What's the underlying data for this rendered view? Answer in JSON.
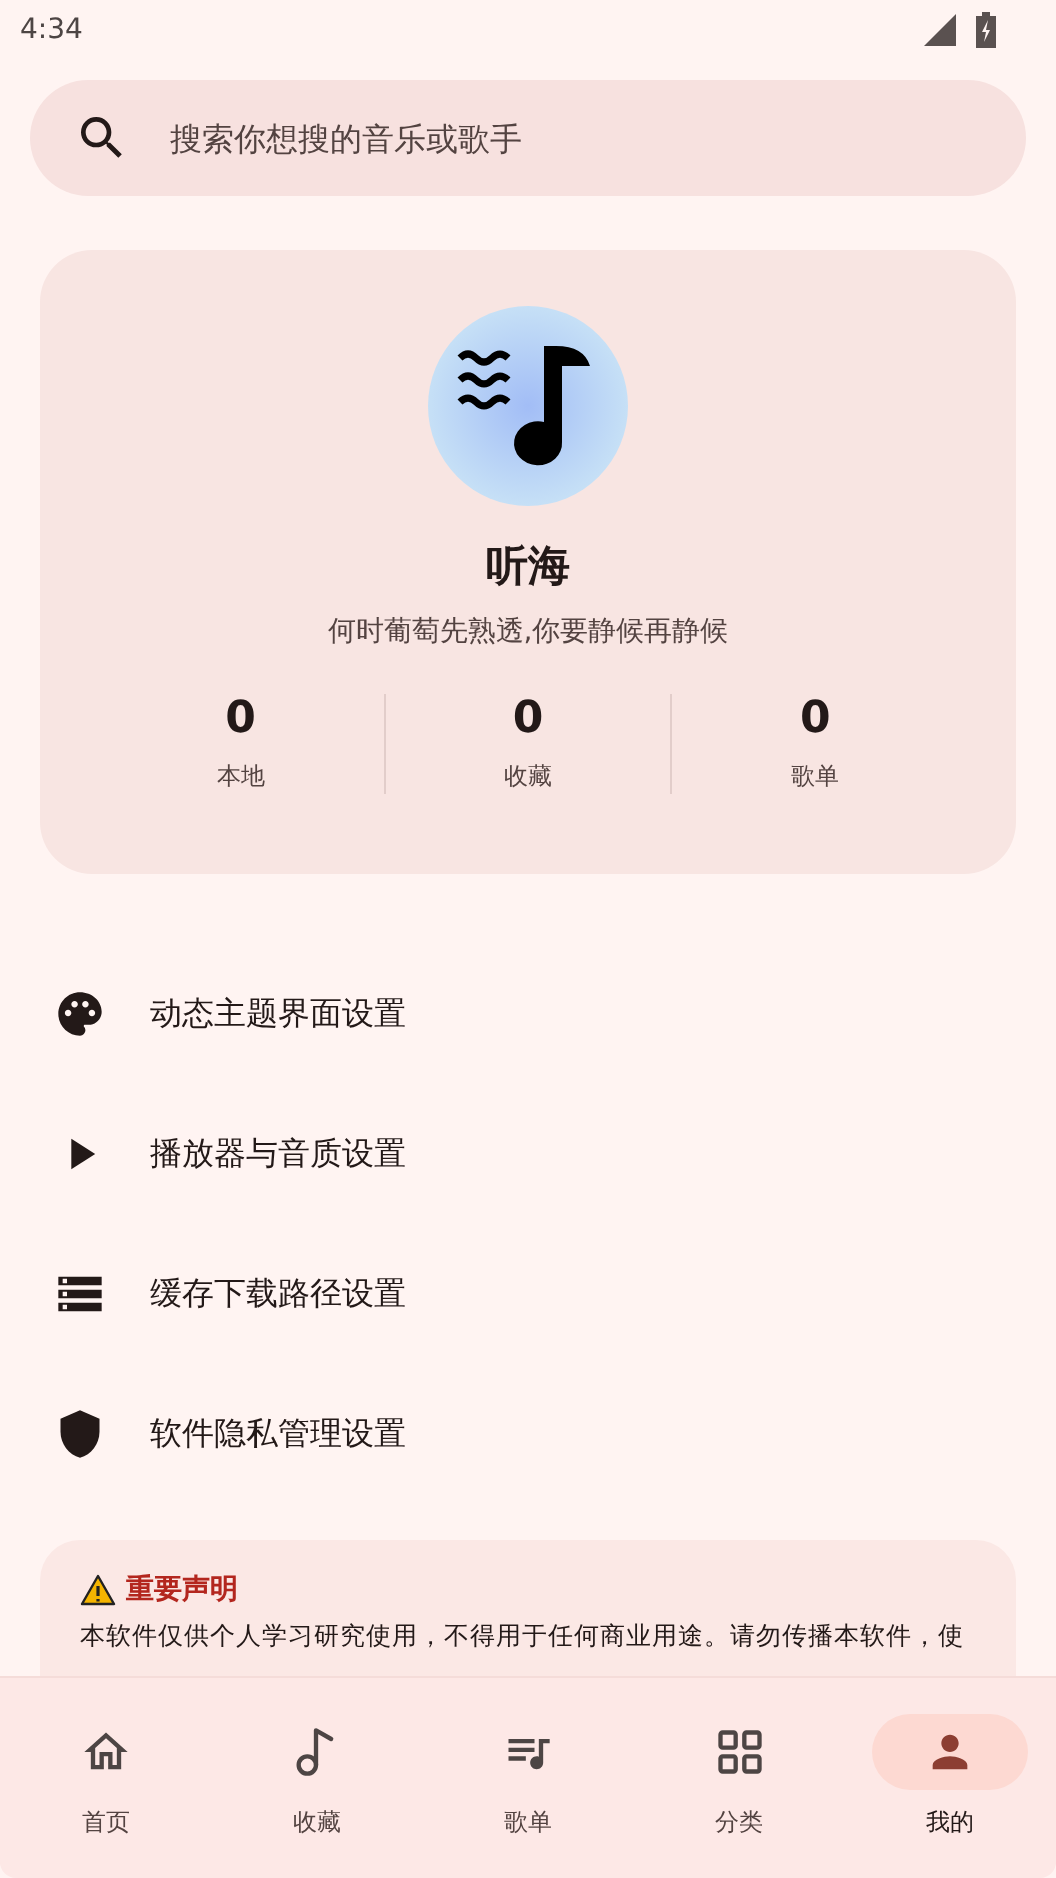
{
  "status_bar": {
    "time": "4:34"
  },
  "search": {
    "placeholder": "搜索你想搜的音乐或歌手"
  },
  "profile": {
    "name": "听海",
    "motto": "何时葡萄先熟透,你要静候再静候",
    "stats": [
      {
        "value": "0",
        "label": "本地"
      },
      {
        "value": "0",
        "label": "收藏"
      },
      {
        "value": "0",
        "label": "歌单"
      }
    ]
  },
  "settings": [
    {
      "kind": "palette",
      "label": "动态主题界面设置"
    },
    {
      "kind": "play",
      "label": "播放器与音质设置"
    },
    {
      "kind": "storage",
      "label": "缓存下载路径设置"
    },
    {
      "kind": "shield",
      "label": "软件隐私管理设置"
    }
  ],
  "notice": {
    "title": "重要声明",
    "text": "本软件仅供个人学习研究使用，不得用于任何商业用途。请勿传播本软件，使"
  },
  "nav": [
    {
      "kind": "home",
      "label": "首页",
      "selected": false
    },
    {
      "kind": "music",
      "label": "收藏",
      "selected": false
    },
    {
      "kind": "list",
      "label": "歌单",
      "selected": false
    },
    {
      "kind": "grid",
      "label": "分类",
      "selected": false
    },
    {
      "kind": "person",
      "label": "我的",
      "selected": true
    }
  ]
}
